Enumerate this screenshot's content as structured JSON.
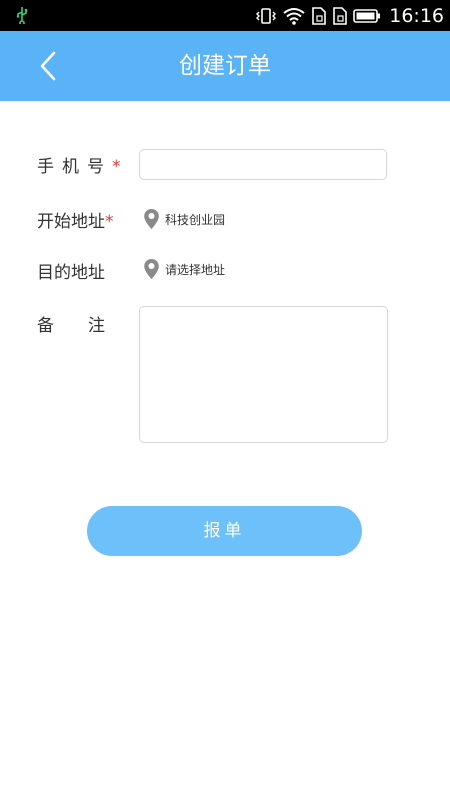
{
  "status_bar": {
    "time": "16:16",
    "icons": [
      "usb-icon",
      "vibrate-icon",
      "wifi-icon",
      "sim1-icon",
      "sim2-icon",
      "battery-icon"
    ]
  },
  "header": {
    "title": "创建订单",
    "back_icon": "chevron-left-icon",
    "background": "#5ab3f7"
  },
  "form": {
    "phone": {
      "label": "手机号",
      "required_mark": "*",
      "value": "",
      "placeholder": ""
    },
    "start_address": {
      "label": "开始地址",
      "required_mark": "*",
      "value": "科技创业园",
      "icon": "location-pin-icon"
    },
    "dest_address": {
      "label": "目的地址",
      "value": "请选择地址",
      "icon": "location-pin-icon"
    },
    "remark": {
      "label_first": "备",
      "label_second": "注",
      "value": ""
    }
  },
  "submit": {
    "label": "报单",
    "color": "#6ec0fa"
  },
  "accent_required": "#e53935"
}
